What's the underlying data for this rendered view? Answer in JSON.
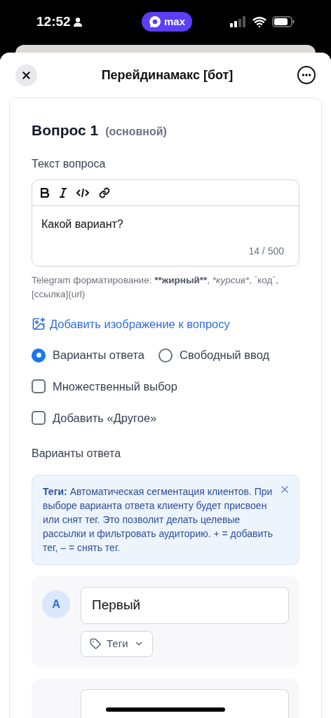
{
  "status_bar": {
    "time": "12:52",
    "app_pill": "max"
  },
  "header": {
    "title": "Перейдинамакс [бот]"
  },
  "question": {
    "title": "Вопрос 1",
    "subtitle": "(основной)",
    "text_label": "Текст вопроса",
    "value": "Какой вариант?",
    "counter": "14 / 500",
    "hint": [
      {
        "text": "Telegram форматирование: ",
        "kind": "plain"
      },
      {
        "text": "**жирный**",
        "kind": "bold"
      },
      {
        "text": ", ",
        "kind": "plain"
      },
      {
        "text": "*курсив*",
        "kind": "italic"
      },
      {
        "text": ", `код`, [ссылка](url)",
        "kind": "plain"
      }
    ],
    "add_image": "Добавить изображение к вопросу"
  },
  "answer_types": [
    {
      "label": "Варианты ответа",
      "selected": true
    },
    {
      "label": "Свободный ввод",
      "selected": false
    }
  ],
  "options": [
    {
      "label": "Множественный выбор",
      "checked": false
    },
    {
      "label": "Добавить «Другое»",
      "checked": false
    }
  ],
  "answers_label": "Варианты ответа",
  "tip": "**Теги:** Автоматическая сегментация клиентов. При выборе варианта ответа клиенту будет присвоен или снят тег. Это позволит делать целевые рассылки и фильтровать аудиторию. + = добавить тег, – = снять тег.",
  "answers": [
    {
      "kind": "filled",
      "letter": "A",
      "value": "Первый",
      "tags_button": "Теги"
    },
    {
      "kind": "blank"
    }
  ]
}
